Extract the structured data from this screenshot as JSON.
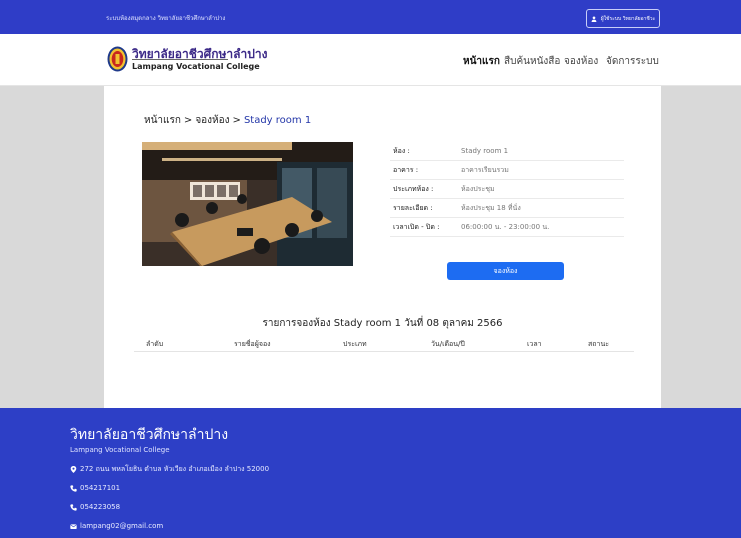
{
  "topbar": {
    "system_name": "ระบบห้องสมุดกลาง วิทยาลัยอาชีวศึกษาลำปาง",
    "user_label": "ผู้ใช้ระบบ วิทยาลัยอาชีวะ",
    "user_icon": "user-icon"
  },
  "brand": {
    "name_th": "วิทยาลัยอาชีวศึกษาลำปาง",
    "name_en": "Lampang Vocational College"
  },
  "nav": {
    "home": "หน้าแรก",
    "search_books": "สืบค้นหนังสือ",
    "book_room": "จองห้อง",
    "manage": "จัดการระบบ"
  },
  "breadcrumb": {
    "home": "หน้าแรก",
    "book_room": "จองห้อง",
    "current": "Stady room 1",
    "separator": ">"
  },
  "room": {
    "details": [
      {
        "label": "ห้อง :",
        "value": "Stady room 1"
      },
      {
        "label": "อาคาร :",
        "value": "อาคารเรียนรวม"
      },
      {
        "label": "ประเภทห้อง :",
        "value": "ห้องประชุม"
      },
      {
        "label": "รายละเอียด :",
        "value": "ห้องประชุม 18 ที่นั่ง"
      },
      {
        "label": "เวลาเปิด - ปิด :",
        "value": "06:00:00 น. - 23:00:00 น."
      }
    ],
    "book_button": "จองห้อง"
  },
  "bookings": {
    "title": "รายการจองห้อง Stady room 1 วันที่ 08 ตุลาคม 2566",
    "columns": [
      "ลำดับ",
      "รายชื่อผู้จอง",
      "ประเภท",
      "วัน/เดือน/ปี",
      "เวลา",
      "สถานะ"
    ],
    "rows": []
  },
  "footer": {
    "title": "วิทยาลัยอาชีวศึกษาลำปาง",
    "subtitle": "Lampang Vocational College",
    "address": "272 ถนน พหลโยธิน ตำบล หัวเวียง อำเภอเมือง ลำปาง 52000",
    "phone1": "054217101",
    "phone2": "054223058",
    "email": "lampang02@gmail.com"
  },
  "colors": {
    "primary": "#2f3dc7",
    "button": "#1d6cf2",
    "page_bg": "#d9d9d9",
    "brand_text": "#3c2a88"
  }
}
